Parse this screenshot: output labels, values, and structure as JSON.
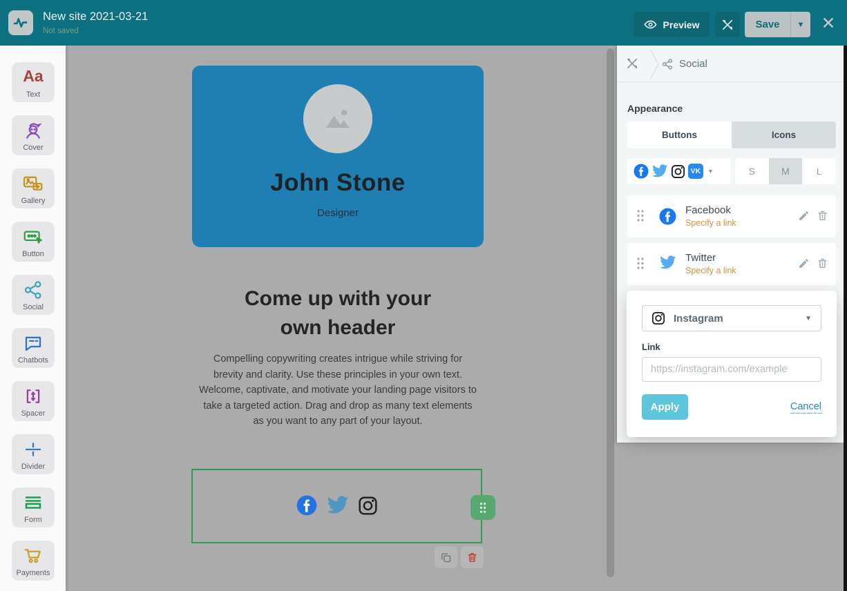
{
  "topbar": {
    "site_title": "New site 2021-03-21",
    "status": "Not saved",
    "preview_label": "Preview",
    "save_label": "Save",
    "close_glyph": "✕"
  },
  "sidebar": {
    "items": [
      {
        "label": "Text",
        "icon": "text-icon"
      },
      {
        "label": "Cover",
        "icon": "cover-icon"
      },
      {
        "label": "Gallery",
        "icon": "gallery-icon"
      },
      {
        "label": "Button",
        "icon": "button-icon"
      },
      {
        "label": "Social",
        "icon": "social-icon"
      },
      {
        "label": "Chatbots",
        "icon": "chatbots-icon"
      },
      {
        "label": "Spacer",
        "icon": "spacer-icon"
      },
      {
        "label": "Divider",
        "icon": "divider-icon"
      },
      {
        "label": "Form",
        "icon": "form-icon"
      },
      {
        "label": "Payments",
        "icon": "payments-icon"
      }
    ],
    "text_icon_glyph": "Aa"
  },
  "canvas": {
    "profile": {
      "name": "John Stone",
      "role": "Designer"
    },
    "heading": "Come up with your own header",
    "paragraph": "Compelling copywriting creates intrigue while striving for brevity and clarity. Use these principles in your own text. Welcome, captivate, and motivate your landing page visitors to take a targeted action. Drag and drop as many text elements as you want to any part of your layout.",
    "social_icons": [
      "facebook",
      "twitter",
      "instagram"
    ]
  },
  "panel": {
    "breadcrumb": {
      "widget_label": "Social"
    },
    "appearance_label": "Appearance",
    "tabs": [
      {
        "label": "Buttons",
        "active": false
      },
      {
        "label": "Icons",
        "active": true
      }
    ],
    "networks_selector": [
      "facebook",
      "twitter",
      "instagram",
      "vk"
    ],
    "vk_label": "VK",
    "sizes": {
      "options": [
        "S",
        "M",
        "L"
      ],
      "selected": "M"
    },
    "items": [
      {
        "name": "Facebook",
        "subtitle": "Specify a link"
      },
      {
        "name": "Twitter",
        "subtitle": "Specify a link"
      }
    ],
    "editor": {
      "network": "Instagram",
      "link_label": "Link",
      "link_placeholder": "https://instagram.com/example",
      "apply_label": "Apply",
      "cancel_label": "Cancel"
    }
  },
  "colors": {
    "topbar_teal": "#0c7080",
    "card_blue": "#1f7eb2",
    "selection_green": "#2f9e53",
    "handle_green": "#57a96d",
    "apply_blue": "#5ec6dc",
    "link_orange": "#d98f3b",
    "cancel_blue": "#1f88d0",
    "facebook_blue": "#1877F2",
    "twitter_blue": "#55acee",
    "vk_blue": "#2787F5"
  }
}
